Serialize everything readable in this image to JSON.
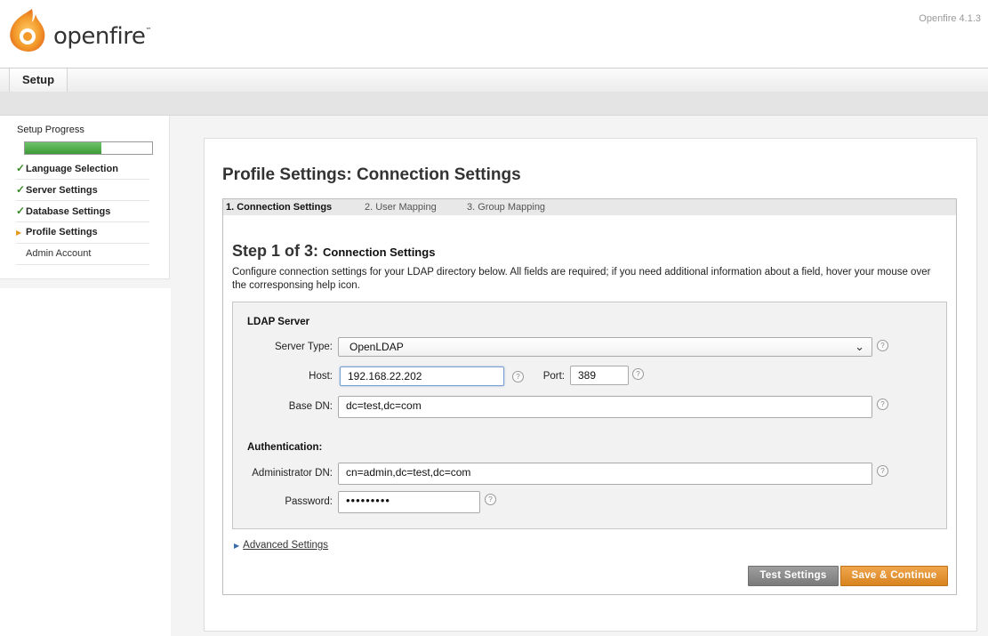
{
  "header": {
    "brand": "openfire",
    "tm": "™",
    "version": "Openfire 4.1.3"
  },
  "tabs": {
    "setup": "Setup"
  },
  "sidebar": {
    "progress_label": "Setup Progress",
    "progress_fraction": 0.6,
    "items": [
      {
        "label": "Language Selection",
        "state": "done",
        "mark": "✓"
      },
      {
        "label": "Server Settings",
        "state": "done",
        "mark": "✓"
      },
      {
        "label": "Database Settings",
        "state": "done",
        "mark": "✓"
      },
      {
        "label": "Profile Settings",
        "state": "current",
        "mark": "▶"
      },
      {
        "label": "Admin Account",
        "state": "todo",
        "mark": ""
      }
    ]
  },
  "main": {
    "title": "Profile Settings: Connection Settings",
    "steps": [
      "1. Connection Settings",
      "2. User Mapping",
      "3. Group Mapping"
    ],
    "step_heading": "Step 1 of 3:",
    "step_sub": "Connection Settings",
    "description": "Configure connection settings for your LDAP directory below. All fields are required; if you need additional information about a field, hover your mouse over the corresponsing help icon.",
    "ldap_section": "LDAP Server",
    "server_type_label": "Server Type:",
    "server_type_value": "OpenLDAP",
    "host_label": "Host:",
    "host_value": "192.168.22.202",
    "port_label": "Port:",
    "port_value": "389",
    "base_dn_label": "Base DN:",
    "base_dn_value": "dc=test,dc=com",
    "auth_section": "Authentication:",
    "admin_dn_label": "Administrator DN:",
    "admin_dn_value": "cn=admin,dc=test,dc=com",
    "password_label": "Password:",
    "password_value": "•••••••••",
    "help_glyph": "?",
    "advanced_label": "Advanced Settings",
    "test_button": "Test Settings",
    "save_button": "Save & Continue"
  },
  "colors": {
    "accent_orange": "#e08d2a",
    "progress_green": "#4caf44",
    "check_green": "#3a8a2a"
  }
}
